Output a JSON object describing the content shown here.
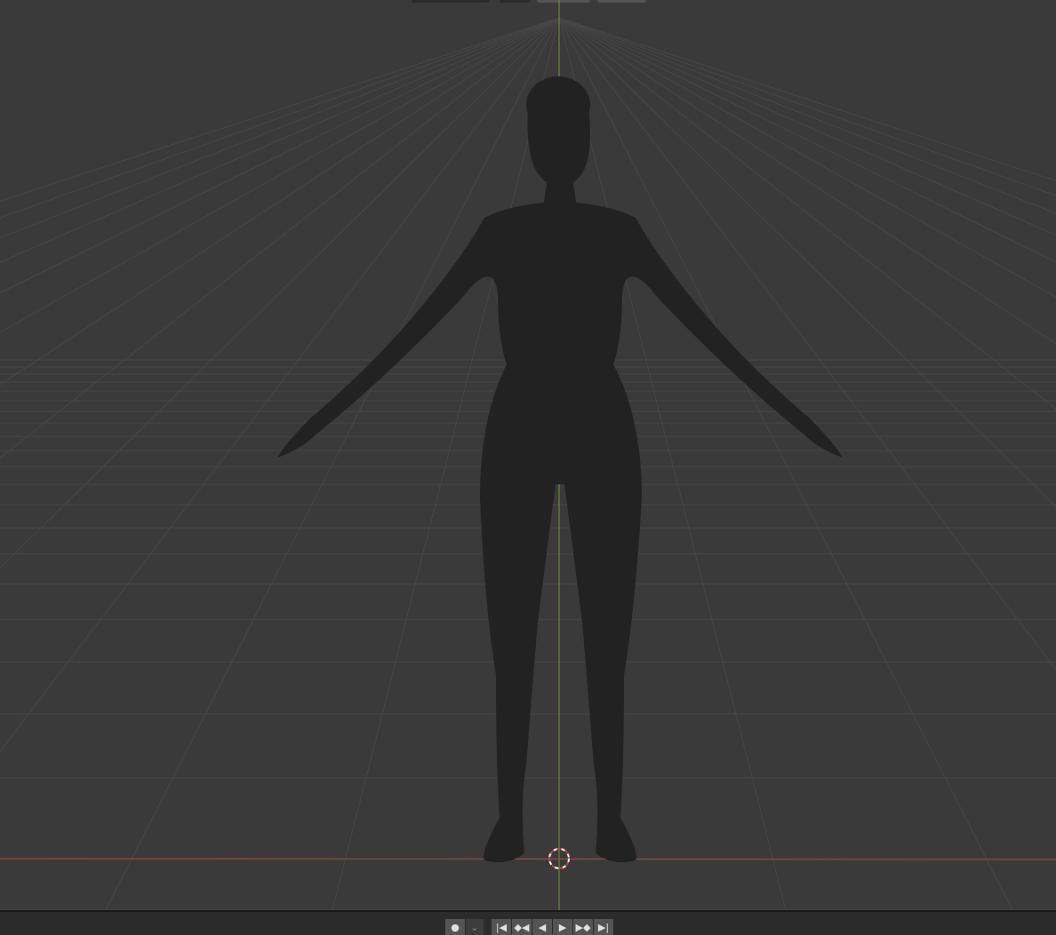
{
  "viewport": {
    "mode": "3D viewport - front view",
    "colors": {
      "background": "#3a3a3a",
      "grid": "#4a4a4a",
      "x_axis": "#c0504f",
      "y_axis": "#6b9a2e",
      "mesh": "#222222"
    }
  },
  "timeline": {
    "buttons": [
      {
        "name": "record-button",
        "icon": "●"
      },
      {
        "name": "keying-dropdown",
        "icon": "⌄"
      },
      {
        "name": "jump-start-button",
        "icon": "|◀"
      },
      {
        "name": "prev-keyframe-button",
        "icon": "◆◀"
      },
      {
        "name": "play-reverse-button",
        "icon": "◀"
      },
      {
        "name": "play-button",
        "icon": "▶"
      },
      {
        "name": "next-keyframe-button",
        "icon": "▶◆"
      },
      {
        "name": "jump-end-button",
        "icon": "▶|"
      }
    ]
  }
}
